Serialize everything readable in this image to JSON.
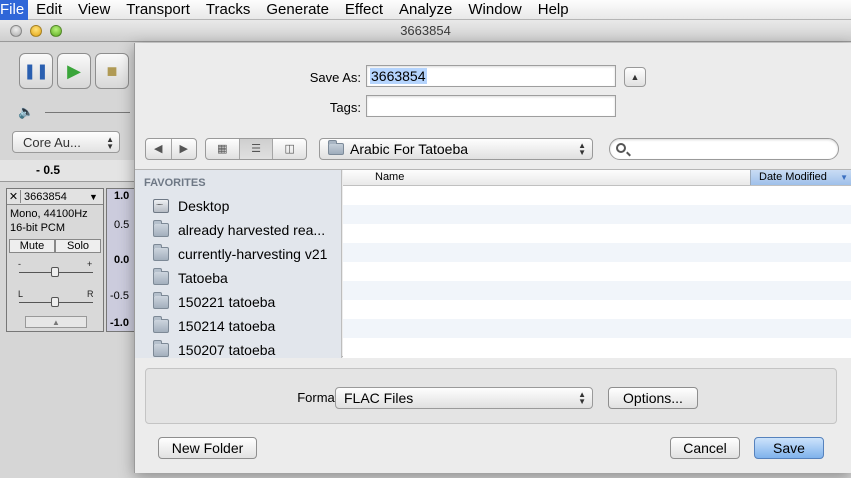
{
  "menubar": {
    "items": [
      "File",
      "Edit",
      "View",
      "Transport",
      "Tracks",
      "Generate",
      "Effect",
      "Analyze",
      "Window",
      "Help"
    ]
  },
  "window": {
    "title": "3663854"
  },
  "audacity": {
    "transport": {
      "pause": "pause-icon",
      "play": "play-icon",
      "stop": "stop-icon"
    },
    "volume_icon": "speaker-icon",
    "host_select": "Core Au...",
    "ruler_label": "- 0.5",
    "track": {
      "name": "3663854",
      "info_1": "Mono, 44100Hz",
      "info_2": "16-bit PCM",
      "mute": "Mute",
      "solo": "Solo",
      "gain_minus": "-",
      "gain_plus": "+",
      "pan_left": "L",
      "pan_right": "R"
    },
    "scale": [
      "1.0",
      "0.5",
      "0.0",
      "-0.5",
      "-1.0"
    ]
  },
  "dialog": {
    "save_as_label": "Save As:",
    "save_as_value": "3663854",
    "tags_label": "Tags:",
    "tags_value": "",
    "location": "Arabic For Tatoeba",
    "search_value": "",
    "sidebar": {
      "header": "FAVORITES",
      "items": [
        {
          "label": "Desktop",
          "icon": "desktop-icon"
        },
        {
          "label": "already harvested rea...",
          "icon": "folder-icon"
        },
        {
          "label": "currently-harvesting v21",
          "icon": "folder-icon"
        },
        {
          "label": "Tatoeba",
          "icon": "folder-icon"
        },
        {
          "label": "150221 tatoeba",
          "icon": "folder-icon"
        },
        {
          "label": "150214 tatoeba",
          "icon": "folder-icon"
        },
        {
          "label": "150207 tatoeba",
          "icon": "folder-icon"
        }
      ]
    },
    "columns": {
      "name": "Name",
      "date": "Date Modified"
    },
    "format_label": "Format:",
    "format_value": "FLAC Files",
    "options_button": "Options...",
    "new_folder_button": "New Folder",
    "cancel_button": "Cancel",
    "save_button": "Save"
  }
}
